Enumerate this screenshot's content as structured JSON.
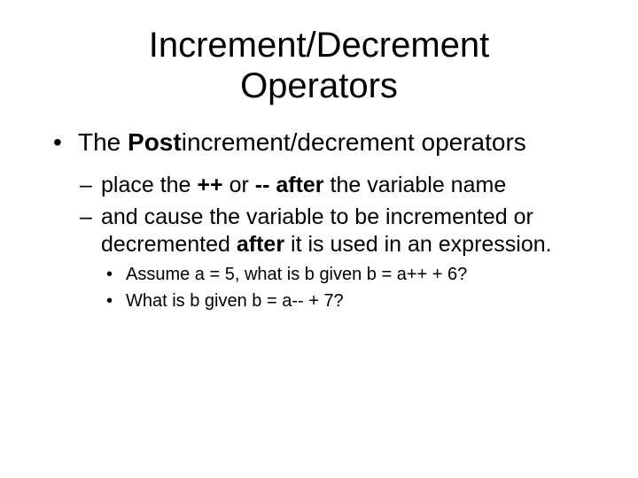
{
  "title_line1": "Increment/Decrement",
  "title_line2": "Operators",
  "l1_pre": "The ",
  "l1_bold": "Post",
  "l1_post": "increment/decrement operators",
  "s1_pre": "place the ",
  "s1_b1": "++",
  "s1_mid": " or ",
  "s1_b2": "--",
  "s1_b3": " after",
  "s1_post": " the variable name",
  "s2_pre": "and cause the variable to be incremented or decremented ",
  "s2_b": "after",
  "s2_post": " it is used in an expression.",
  "ex1": "Assume a = 5,  what is b given b = a++ + 6?",
  "ex2": "What is b given b = a-- + 7?"
}
